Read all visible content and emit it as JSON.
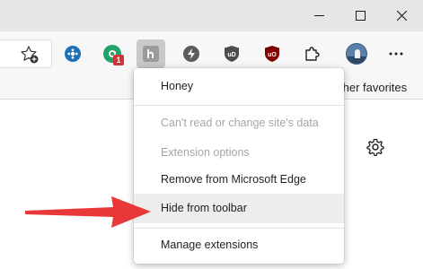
{
  "window_controls": {
    "minimize": "minimize-icon",
    "maximize": "maximize-icon",
    "close": "close-icon"
  },
  "toolbar": {
    "icons": [
      "add-to-favorites-icon",
      "extension-blue-icon",
      "extension-green-icon",
      "honey-extension-icon",
      "extension-gray-icon",
      "extension-shield-icon",
      "ublock-origin-icon",
      "extensions-puzzle-icon",
      "profile-avatar",
      "more-options-icon"
    ],
    "badge_count": "1"
  },
  "favorites_bar": {
    "other_favorites": "ther favorites"
  },
  "context_menu": {
    "items": [
      {
        "label": "Honey",
        "disabled": false
      },
      {
        "label": "Can't read or change site's data",
        "disabled": true
      },
      {
        "label": "Extension options",
        "disabled": true
      },
      {
        "label": "Remove from Microsoft Edge",
        "disabled": false
      },
      {
        "label": "Hide from toolbar",
        "disabled": false,
        "highlighted": true
      },
      {
        "label": "Manage extensions",
        "disabled": false
      }
    ]
  },
  "colors": {
    "accent_arrow": "#e8383a",
    "menu_hover": "#ededed",
    "disabled_text": "#a6a6a6",
    "badge": "#d13438"
  }
}
